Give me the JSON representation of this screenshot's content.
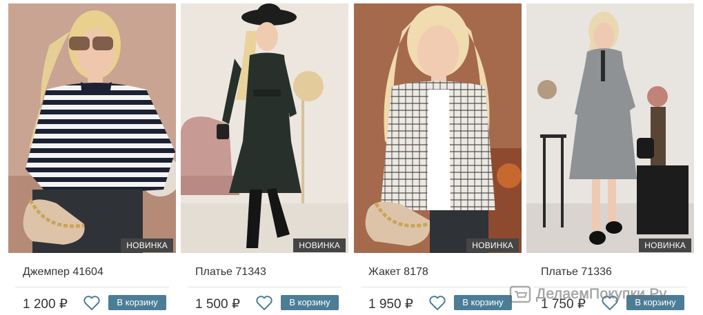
{
  "products": [
    {
      "name": "Джемпер 41604",
      "price": "1 200 ₽",
      "badge": "НОВИНКА",
      "cart_label": "В корзину"
    },
    {
      "name": "Платье 71343",
      "price": "1 500 ₽",
      "badge": "НОВИНКА",
      "cart_label": "В корзину"
    },
    {
      "name": "Жакет 8178",
      "price": "1 950 ₽",
      "badge": "НОВИНКА",
      "cart_label": "В корзину"
    },
    {
      "name": "Платье 71336",
      "price": "1 750 ₽",
      "badge": "НОВИНКА",
      "cart_label": "В корзину"
    }
  ],
  "watermark": {
    "text": "ДелаемПокупки.Ру",
    "icon": "shopping-cart-icon"
  },
  "colors": {
    "button": "#4c7d96",
    "badge": "#454545",
    "heart": "#4c7d96"
  }
}
